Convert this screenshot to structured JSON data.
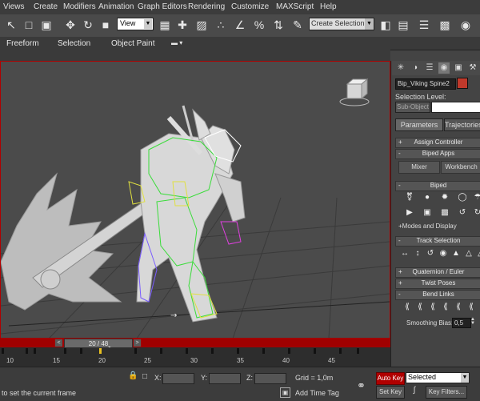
{
  "menu": {
    "items": [
      "Views",
      "Create",
      "Modifiers",
      "Animation",
      "Graph Editors",
      "Rendering",
      "Customize",
      "MAXScript",
      "Help"
    ]
  },
  "toolbar": {
    "view_select": "View",
    "selection_set_placeholder": "Create Selection Se"
  },
  "ribbon": {
    "tabs": [
      "Freeform",
      "Selection",
      "Object Paint"
    ]
  },
  "timeslider": {
    "label": "20 / 48",
    "current": 20,
    "total": 48
  },
  "trackbar": {
    "tick_labels": [
      "10",
      "15",
      "20",
      "25",
      "30",
      "35",
      "40",
      "45"
    ]
  },
  "status": {
    "prompt": "to set the current frame",
    "x_label": "X:",
    "y_label": "Y:",
    "z_label": "Z:",
    "grid": "Grid = 1,0m",
    "add_time_tag": "Add Time Tag",
    "auto_key": "Auto Key",
    "selected": "Selected",
    "set_key": "Set Key",
    "key_filters": "Key Filters..."
  },
  "command_panel": {
    "object_name": "Bip_Viking Spine2",
    "object_color": "#c0392b",
    "selection_level": "Selection Level:",
    "sub_object": "Sub-Object",
    "tabs": [
      "Parameters",
      "Trajectories"
    ],
    "rollouts": {
      "assign_controller": "Assign Controller",
      "biped_apps": "Biped Apps",
      "biped": "Biped",
      "track_selection": "Track Selection",
      "quaternion_euler": "Quaternion / Euler",
      "twist_poses": "Twist Poses",
      "bend_links": "Bend Links"
    },
    "mixer": "Mixer",
    "workbench": "Workbench",
    "modes_display": "Modes and Display",
    "smoothing_bias_label": "Smoothing Bias:",
    "smoothing_bias_value": "0,5"
  },
  "colors": {
    "viewport_border": "#b00000",
    "auto_key": "#b00000"
  }
}
